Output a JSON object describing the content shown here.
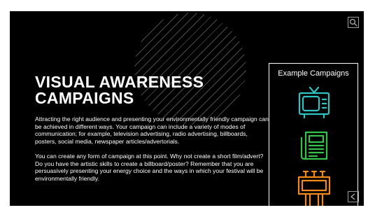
{
  "slide": {
    "title_line1": "VISUAL AWARENESS",
    "title_line2": "CAMPAIGNS",
    "paragraph1": "Attracting the right audience and presenting your environmentally friendly campaign can be achieved in different ways. Your campaign can include a variety of modes of communication; for example, television advertising, radio advertising, billboards, posters, social media, newspaper articles/advertorials.",
    "paragraph2": "You can create any form of campaign at this point. Why not create a short film/advert? Do you have the artistic skills to create a billboard/poster? Remember that you are persuasively presenting your energy choice and the ways in which your festival will be environmentally friendly."
  },
  "panel": {
    "title": "Example Campaigns",
    "icons": [
      "television-icon",
      "newspaper-icon",
      "billboard-icon"
    ]
  },
  "controls": {
    "zoom_icon": "magnifier-icon",
    "back_icon": "chevron-left-icon"
  },
  "colors": {
    "background": "#000000",
    "television": "#2ec4c4",
    "newspaper": "#36c24a",
    "billboard": "#f08a1c"
  }
}
